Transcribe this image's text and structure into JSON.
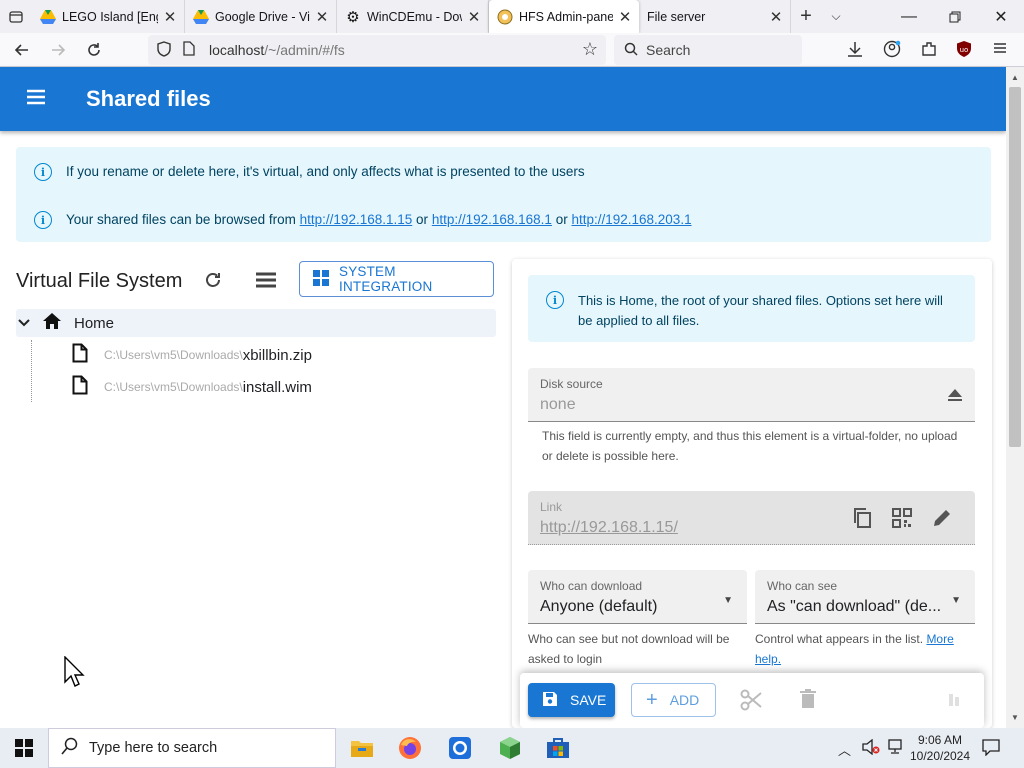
{
  "browser": {
    "tabs": [
      {
        "title": "LEGO Island [Engli",
        "icon": "google-drive-icon"
      },
      {
        "title": "Google Drive - Vir",
        "icon": "google-drive-icon"
      },
      {
        "title": "WinCDEmu - Dow",
        "icon": "gear-icon"
      },
      {
        "title": "HFS Admin-panel",
        "icon": "hfs-icon",
        "active": true
      },
      {
        "title": "File server",
        "icon": ""
      }
    ],
    "url_host": "localhost",
    "url_path": "/~/admin/#/fs",
    "search_placeholder": "Search"
  },
  "app": {
    "title": "Shared files",
    "accent": "#1976d2"
  },
  "alerts": {
    "line1": "If you rename or delete here, it's virtual, and only affects what is presented to the users",
    "line2_prefix": "Your shared files can be browsed from",
    "links": [
      "http://192.168.1.15",
      "http://192.168.168.1",
      "http://192.168.203.1"
    ],
    "or": "or"
  },
  "vfs": {
    "title": "Virtual File System",
    "system_integration": "SYSTEM INTEGRATION",
    "home": "Home",
    "files": [
      {
        "path": "C:\\Users\\vm5\\Downloads\\",
        "name": "xbillbin.zip"
      },
      {
        "path": "C:\\Users\\vm5\\Downloads\\",
        "name": "install.wim"
      }
    ]
  },
  "panel": {
    "info": "This is Home, the root of your shared files. Options set here will be applied to all files.",
    "disk_source_label": "Disk source",
    "disk_source_value": "none",
    "disk_source_help": "This field is currently empty, and thus this element is a virtual-folder, no upload or delete is possible here.",
    "link_label": "Link",
    "link_value": "http://192.168.1.15/",
    "who_download_label": "Who can download",
    "who_download_value": "Anyone (default)",
    "who_download_help": "Who can see but not download will be asked to login",
    "who_see_label": "Who can see",
    "who_see_value": "As \"can download\" (de...",
    "who_see_help": "Control what appears in the list.",
    "more_help": "More help."
  },
  "actions": {
    "save": "SAVE",
    "add": "ADD"
  },
  "taskbar": {
    "search_placeholder": "Type here to search",
    "time": "9:06 AM",
    "date": "10/20/2024"
  }
}
